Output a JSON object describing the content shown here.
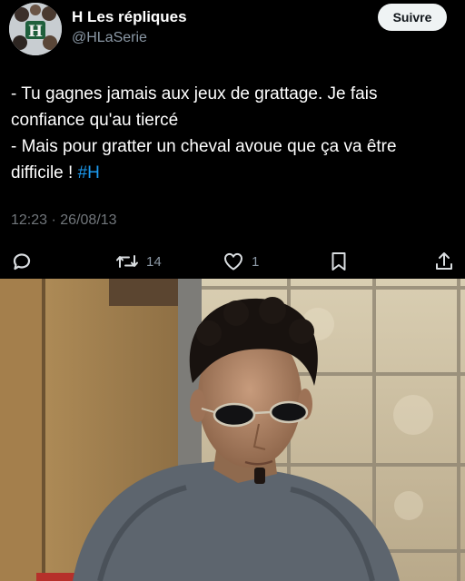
{
  "account": {
    "display_name": "H Les répliques",
    "handle": "@HLaSerie",
    "avatar_letter": "H"
  },
  "follow_button": {
    "label": "Suivre"
  },
  "tweet": {
    "lines": [
      "- Tu gagnes jamais aux jeux de grattage. Je fais",
      "confiance qu'au tiercé",
      "- Mais pour gratter un cheval avoue que ça va être"
    ],
    "last_line_text": "difficile ! ",
    "hashtag": "#H",
    "time": "12:23",
    "separator": "·",
    "date": "26/08/13"
  },
  "actions": {
    "reply_icon": "reply-icon",
    "retweet_icon": "retweet-icon",
    "retweet_count": "14",
    "like_icon": "heart-icon",
    "like_count": "1",
    "bookmark_icon": "bookmark-icon",
    "share_icon": "share-icon"
  },
  "colors": {
    "background": "#000000",
    "text": "#ffffff",
    "secondary": "#71767b",
    "hashtag": "#1d9bf0",
    "follow_bg": "#eff3f4"
  }
}
